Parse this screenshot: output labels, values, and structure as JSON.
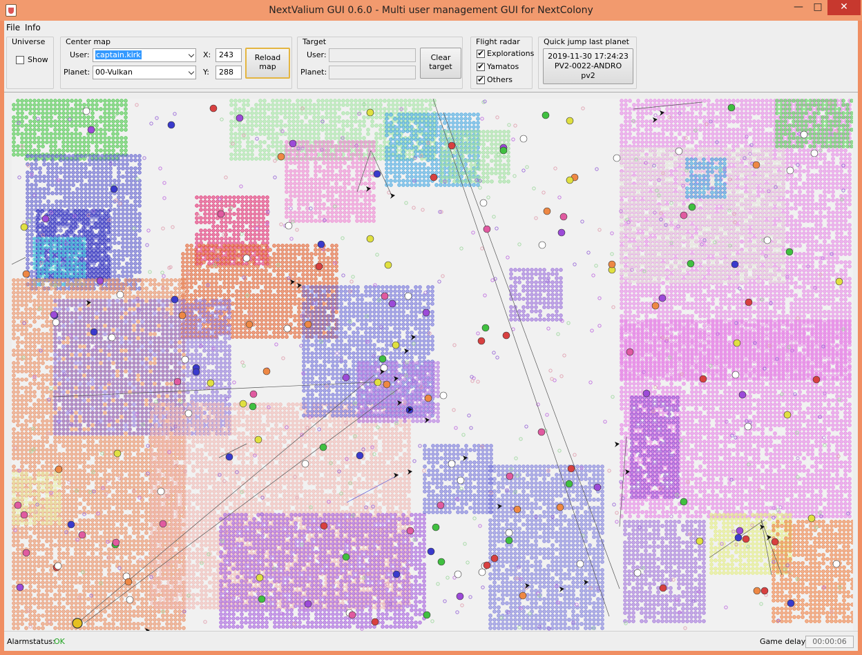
{
  "window": {
    "title": "NextValium GUI 0.6.0 - Multi user management GUI for NextColony"
  },
  "menu": {
    "items": [
      "File",
      "Info"
    ]
  },
  "universe": {
    "title": "Universe",
    "show_label": "Show",
    "show_checked": false
  },
  "center_map": {
    "title": "Center map",
    "user_label": "User:",
    "user_value": "captain.kirk",
    "planet_label": "Planet:",
    "planet_value": "00-Vulkan",
    "x_label": "X:",
    "x_value": "243",
    "y_label": "Y:",
    "y_value": "288",
    "reload_label_1": "Reload",
    "reload_label_2": "map"
  },
  "target": {
    "title": "Target",
    "user_label": "User:",
    "user_value": "",
    "planet_label": "Planet:",
    "planet_value": "",
    "clear_label_1": "Clear",
    "clear_label_2": "target"
  },
  "flight_radar": {
    "title": "Flight radar",
    "options": [
      {
        "label": "Explorations",
        "checked": true
      },
      {
        "label": "Yamatos",
        "checked": true
      },
      {
        "label": "Others",
        "checked": true
      }
    ]
  },
  "quick_jump": {
    "title": "Quick jump last planet",
    "line1": "2019-11-30 17:24:23",
    "line2": "PV2-0022-ANDRO",
    "line3": "pv2"
  },
  "status": {
    "alarm_label": "Alarmstatus:",
    "alarm_value": "OK",
    "delay_label": "Game delay:",
    "delay_value": "00:00:06"
  },
  "colors": {
    "titlebar": "#f29a6e",
    "close_button": "#c7382e",
    "ok_status": "#1fa31f",
    "selection": "#3399ff"
  }
}
